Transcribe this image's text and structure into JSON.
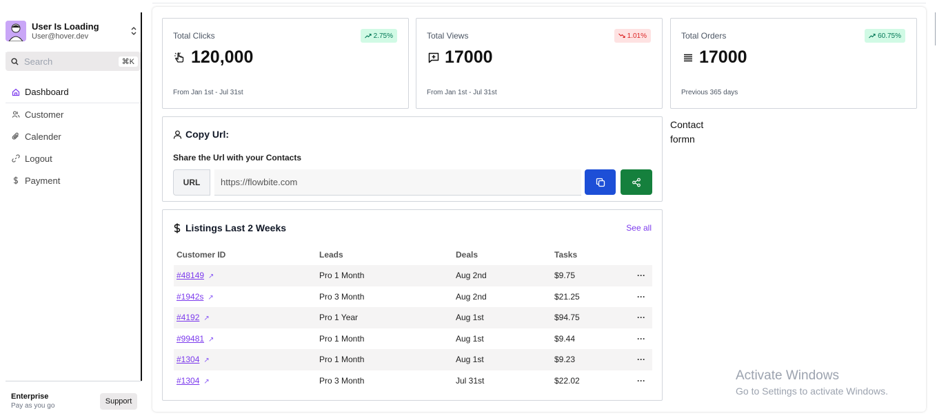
{
  "user": {
    "name": "User Is Loading",
    "email": "User@hover.dev"
  },
  "search": {
    "placeholder": "Search",
    "shortcut": "⌘K"
  },
  "nav": {
    "items": [
      {
        "label": "Dashboard",
        "icon": "home-icon",
        "active": true
      },
      {
        "label": "Customer",
        "icon": "users-icon"
      },
      {
        "label": "Calender",
        "icon": "paperclip-icon"
      },
      {
        "label": "Logout",
        "icon": "link-icon"
      },
      {
        "label": "Payment",
        "icon": "dollar-icon"
      }
    ]
  },
  "plan": {
    "name": "Enterprise",
    "subtitle": "Pay as you go",
    "support_label": "Support"
  },
  "stats": [
    {
      "label": "Total Clicks",
      "value": "120,000",
      "change": "2.75%",
      "trend": "up",
      "footer": "From Jan 1st - Jul 31st",
      "icon": "pointer-click-icon"
    },
    {
      "label": "Total Views",
      "value": "17000",
      "change": "1.01%",
      "trend": "down",
      "footer": "From Jan 1st - Jul 31st",
      "icon": "message-plus-icon"
    },
    {
      "label": "Total Orders",
      "value": "17000",
      "change": "60.75%",
      "trend": "up",
      "footer": "Previous 365 days",
      "icon": "list-icon"
    }
  ],
  "copy_url": {
    "title": "Copy Url:",
    "subtitle": "Share the Url with your Contacts",
    "prefix": "URL",
    "value": "https://flowbite.com"
  },
  "listings": {
    "title": "Listings Last 2 Weeks",
    "see_all": "See all",
    "columns": [
      "Customer ID",
      "Leads",
      "Deals",
      "Tasks"
    ],
    "rows": [
      {
        "id": "#48149",
        "leads": "Pro 1 Month",
        "deals": "Aug 2nd",
        "tasks": "$9.75"
      },
      {
        "id": "#1942s",
        "leads": "Pro 3 Month",
        "deals": "Aug 2nd",
        "tasks": "$21.25"
      },
      {
        "id": "#4192",
        "leads": "Pro 1 Year",
        "deals": "Aug 1st",
        "tasks": "$94.75"
      },
      {
        "id": "#99481",
        "leads": "Pro 1 Month",
        "deals": "Aug 1st",
        "tasks": "$9.44"
      },
      {
        "id": "#1304",
        "leads": "Pro 1 Month",
        "deals": "Aug 1st",
        "tasks": "$9.23"
      },
      {
        "id": "#1304",
        "leads": "Pro 3 Month",
        "deals": "Jul 31st",
        "tasks": "$22.02"
      }
    ],
    "more_label": "···"
  },
  "contact": {
    "line1": "Contact",
    "line2": "formn"
  },
  "activate_windows": {
    "title": "Activate Windows",
    "subtitle": "Go to Settings to activate Windows."
  },
  "colors": {
    "accent": "#7c3aed",
    "copy_button": "#1d4fd7",
    "share_button": "#15803d",
    "trend_up_bg": "#d1fae5",
    "trend_down_bg": "#fee2e2"
  }
}
